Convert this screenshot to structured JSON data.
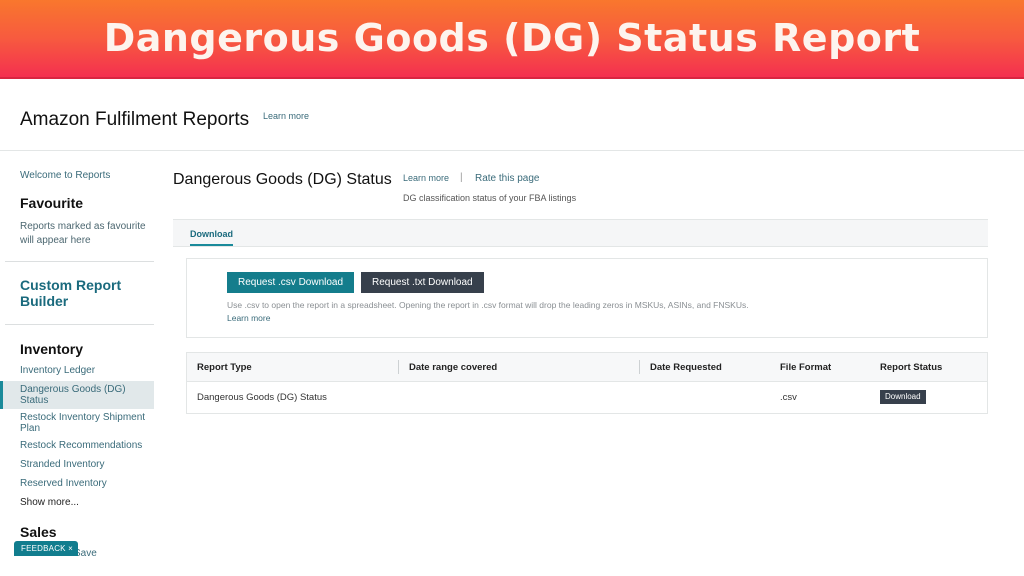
{
  "banner": {
    "title": "Dangerous Goods (DG) Status Report"
  },
  "header": {
    "title": "Amazon Fulfilment Reports",
    "learn_more": "Learn more"
  },
  "sidebar": {
    "welcome": "Welcome to Reports",
    "favourite_heading": "Favourite",
    "favourite_note": "Reports marked as favourite will appear here",
    "custom_report_builder": "Custom Report Builder",
    "inventory_heading": "Inventory",
    "inventory_items": [
      {
        "label": "Inventory Ledger",
        "active": false
      },
      {
        "label": "Dangerous Goods (DG) Status",
        "active": true
      },
      {
        "label": "Restock Inventory Shipment Plan",
        "active": false
      },
      {
        "label": "Restock Recommendations",
        "active": false
      },
      {
        "label": "Stranded Inventory",
        "active": false
      },
      {
        "label": "Reserved Inventory",
        "active": false
      }
    ],
    "show_more": "Show more...",
    "sales_heading": "Sales",
    "sales_partial_item": "Save",
    "feedback_label": "FEEDBACK ×"
  },
  "main": {
    "page_title": "Dangerous Goods (DG) Status",
    "learn_more": "Learn more",
    "separator": "|",
    "rate_page": "Rate this page",
    "description": "DG classification status of your FBA listings",
    "tabs": [
      {
        "label": "Download",
        "active": true
      }
    ],
    "download": {
      "csv_button": "Request .csv Download",
      "txt_button": "Request .txt Download",
      "note": "Use .csv to open the report in a spreadsheet. Opening the report in .csv format will drop the leading zeros in MSKUs, ASINs, and FNSKUs.",
      "learn_more": "Learn more"
    },
    "table": {
      "columns": [
        "Report Type",
        "Date range covered",
        "Date Requested",
        "File Format",
        "Report Status"
      ],
      "rows": [
        {
          "report_type": "Dangerous Goods (DG) Status",
          "date_range": "",
          "date_requested": "",
          "file_format": ".csv",
          "status_button": "Download"
        }
      ]
    }
  },
  "colors": {
    "banner_top": "#f9772d",
    "banner_bottom": "#f4304f",
    "accent_teal": "#147d8c",
    "dark_button": "#37404c",
    "link": "#3a6b7a"
  }
}
